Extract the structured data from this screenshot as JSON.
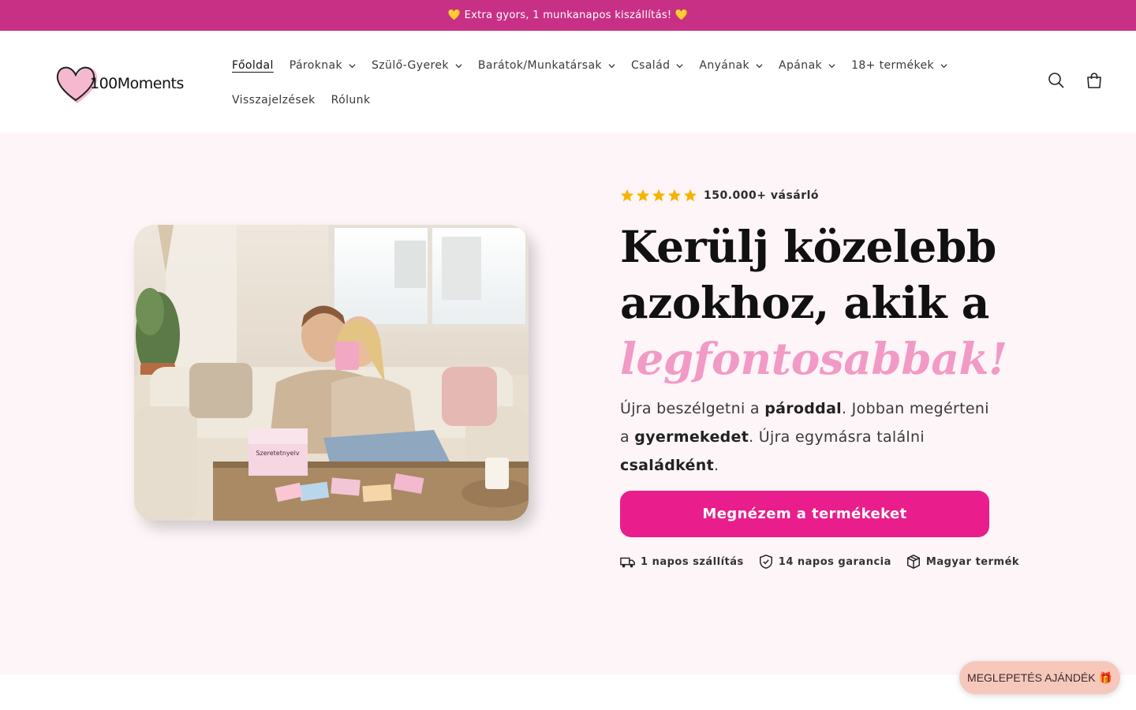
{
  "announcement": {
    "text": "💛 Extra gyors, 1 munkanapos kiszállítás! 💛"
  },
  "brand": {
    "logo_text": "100Moments",
    "accent_color": "#e91e8c",
    "bar_color": "#c83086"
  },
  "nav": {
    "items": [
      {
        "label": "Főoldal",
        "has_dropdown": false,
        "active": true
      },
      {
        "label": "Pároknak",
        "has_dropdown": true
      },
      {
        "label": "Szülő-Gyerek",
        "has_dropdown": true
      },
      {
        "label": "Barátok/Munkatársak",
        "has_dropdown": true
      },
      {
        "label": "Család",
        "has_dropdown": true
      },
      {
        "label": "Anyának",
        "has_dropdown": true
      },
      {
        "label": "Apának",
        "has_dropdown": true
      },
      {
        "label": "18+ termékek",
        "has_dropdown": true
      },
      {
        "label": "Visszajelzések",
        "has_dropdown": false
      },
      {
        "label": "Rólunk",
        "has_dropdown": false
      }
    ]
  },
  "header_icons": {
    "search": "search-icon",
    "cart": "cart-icon"
  },
  "hero": {
    "rating": {
      "stars": 5,
      "text": "150.000+ vásárló"
    },
    "headline_line1": "Kerülj közelebb",
    "headline_line2": "azokhoz, akik a",
    "headline_accent": "legfontosabbak!",
    "subtitle": {
      "p1": "Újra beszélgetni a ",
      "b1": "pároddal",
      "p2": ". Jobban megérteni a ",
      "b2": "gyermekedet",
      "p3": ". Újra egymásra találni ",
      "b3": "családként",
      "p4": "."
    },
    "cta_label": "Megnézem a termékeket",
    "badges": [
      {
        "icon": "truck-icon",
        "label": "1 napos szállítás"
      },
      {
        "icon": "shield-check-icon",
        "label": "14 napos garancia"
      },
      {
        "icon": "box-icon",
        "label": "Magyar termék"
      }
    ],
    "image_box_label": "Szeretetnyelv"
  },
  "gift_button": {
    "label": "MEGLEPETÉS AJÁNDÉK 🎁"
  }
}
